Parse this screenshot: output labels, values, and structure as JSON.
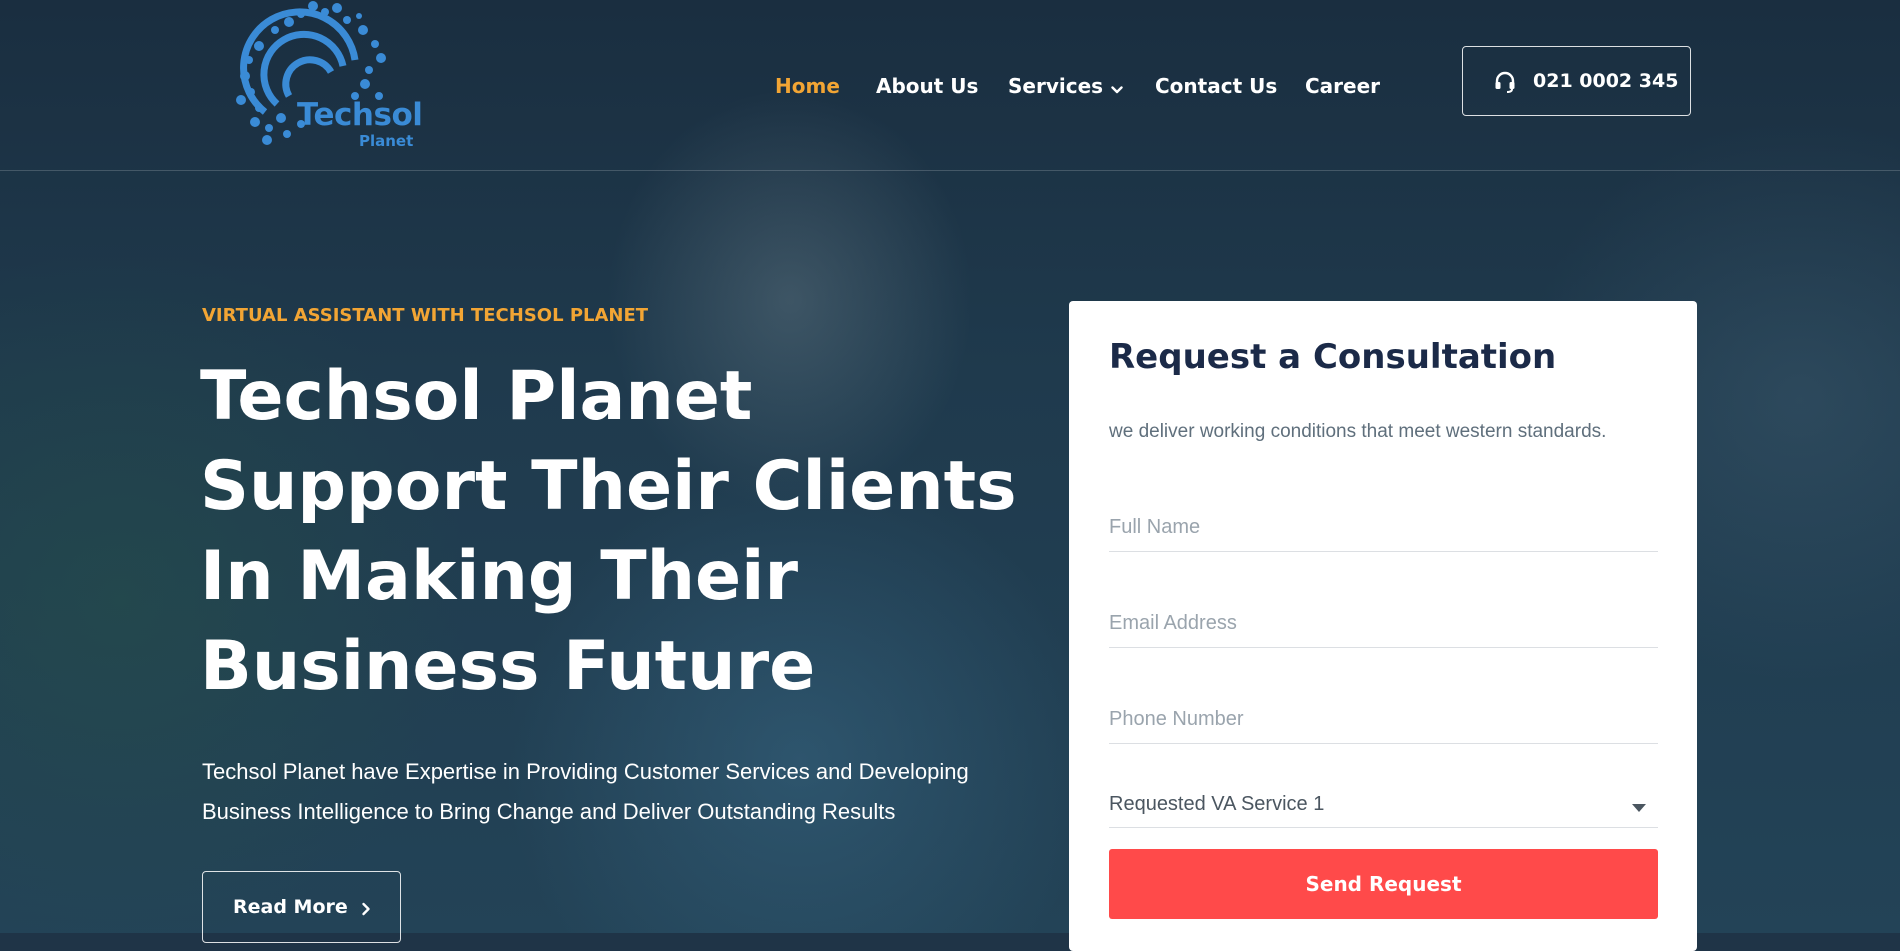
{
  "brand": {
    "name": "Techsol",
    "sub": "Planet",
    "color": "#3a8bd6"
  },
  "nav": {
    "items": [
      {
        "label": "Home",
        "active": true
      },
      {
        "label": "About Us"
      },
      {
        "label": "Services",
        "has_dropdown": true
      },
      {
        "label": "Contact Us"
      },
      {
        "label": "Career"
      }
    ],
    "phone": {
      "label": "021 0002 345",
      "icon": "headset-icon"
    }
  },
  "hero": {
    "eyebrow": "VIRTUAL ASSISTANT WITH TECHSOL PLANET",
    "headline_lines": [
      "Techsol Planet",
      "Support Their Clients",
      "In Making Their",
      "Business Future"
    ],
    "lead": "Techsol Planet have Expertise in Providing Customer Services and Developing Business Intelligence to Bring Change and Deliver Outstanding Results",
    "read_more": {
      "label": "Read More",
      "icon": "chevron-right-icon"
    }
  },
  "form": {
    "title": "Request a Consultation",
    "subtitle": "we deliver working conditions that meet western standards.",
    "full_name": {
      "placeholder": "Full Name",
      "value": ""
    },
    "email": {
      "placeholder": "Email Address",
      "value": ""
    },
    "phone": {
      "placeholder": "Phone Number",
      "value": ""
    },
    "service_select": {
      "value": "Requested VA Service 1"
    },
    "submit_label": "Send Request"
  },
  "colors": {
    "accent": "#f2a534",
    "submit": "#ff4a4a",
    "title": "#1b2a48"
  }
}
